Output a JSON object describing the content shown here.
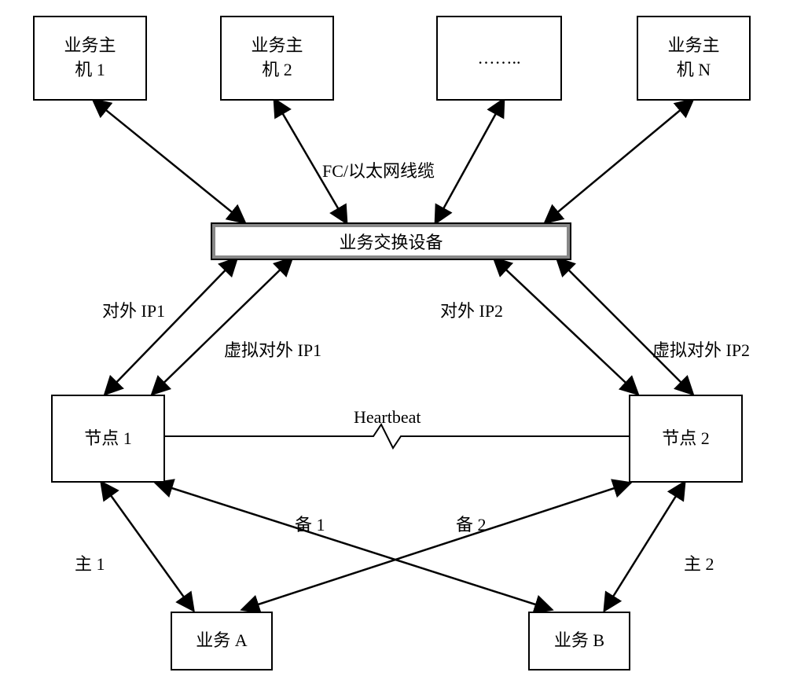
{
  "hosts": {
    "host1": "业务主\n机 1",
    "host2": "业务主\n机 2",
    "hostEllipsis": "……..",
    "hostN": "业务主\n机 N"
  },
  "switch": {
    "label": "业务交换设备",
    "cableLabel": "FC/以太网线缆"
  },
  "nodes": {
    "node1": "节点 1",
    "node2": "节点 2",
    "heartbeat": "Heartbeat"
  },
  "ips": {
    "externalIP1": "对外 IP1",
    "virtualIP1": "虚拟对外 IP1",
    "externalIP2": "对外 IP2",
    "virtualIP2": "虚拟对外 IP2"
  },
  "services": {
    "serviceA": "业务 A",
    "serviceB": "业务 B"
  },
  "roles": {
    "primary1": "主 1",
    "backup1": "备 1",
    "primary2": "主 2",
    "backup2": "备 2"
  }
}
